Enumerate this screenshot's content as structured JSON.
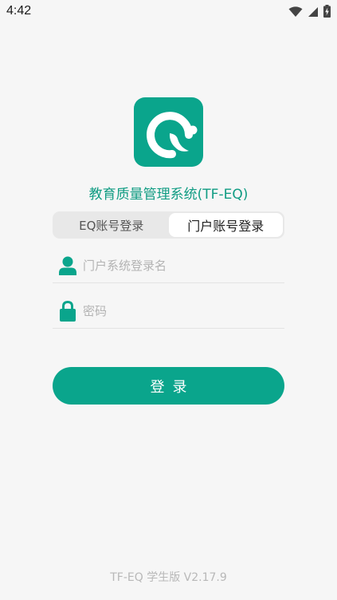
{
  "status_bar": {
    "time": "4:42",
    "icons": [
      "wifi-icon",
      "signal-icon",
      "battery-charging-icon"
    ]
  },
  "app": {
    "title": "教育质量管理系统(TF-EQ)",
    "brand_color": "#0aa58c"
  },
  "tabs": [
    {
      "label": "EQ账号登录",
      "active": false
    },
    {
      "label": "门户账号登录",
      "active": true
    }
  ],
  "form": {
    "username": {
      "placeholder": "门户系统登录名",
      "value": "",
      "icon": "user-icon"
    },
    "password": {
      "placeholder": "密码",
      "value": "",
      "icon": "lock-icon"
    },
    "submit_label": "登录"
  },
  "footer": {
    "version": "TF-EQ 学生版  V2.17.9"
  }
}
